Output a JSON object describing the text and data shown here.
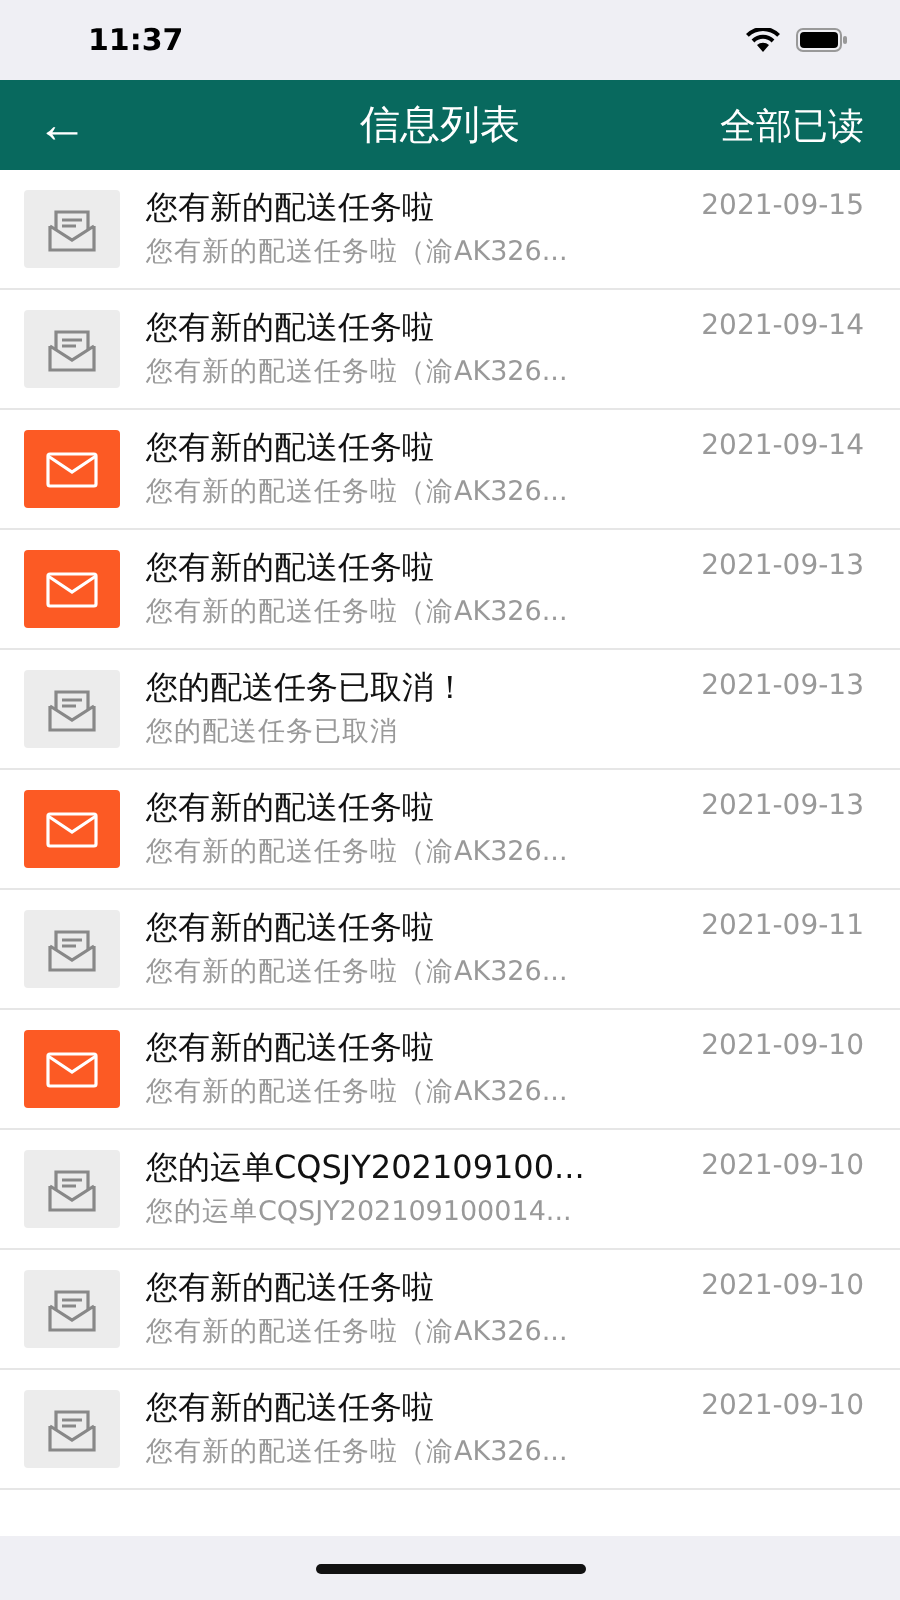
{
  "status_bar": {
    "time": "11:37"
  },
  "header": {
    "back": "←",
    "title": "信息列表",
    "action": "全部已读"
  },
  "messages": [
    {
      "title": "您有新的配送任务啦",
      "preview": "您有新的配送任务啦（渝AK326...",
      "date": "2021-09-15",
      "read": true
    },
    {
      "title": "您有新的配送任务啦",
      "preview": "您有新的配送任务啦（渝AK326...",
      "date": "2021-09-14",
      "read": true
    },
    {
      "title": "您有新的配送任务啦",
      "preview": "您有新的配送任务啦（渝AK326...",
      "date": "2021-09-14",
      "read": false
    },
    {
      "title": "您有新的配送任务啦",
      "preview": "您有新的配送任务啦（渝AK326...",
      "date": "2021-09-13",
      "read": false
    },
    {
      "title": "您的配送任务已取消！",
      "preview": "您的配送任务已取消",
      "date": "2021-09-13",
      "read": true
    },
    {
      "title": "您有新的配送任务啦",
      "preview": "您有新的配送任务啦（渝AK326...",
      "date": "2021-09-13",
      "read": false
    },
    {
      "title": "您有新的配送任务啦",
      "preview": "您有新的配送任务啦（渝AK326...",
      "date": "2021-09-11",
      "read": true
    },
    {
      "title": "您有新的配送任务啦",
      "preview": "您有新的配送任务啦（渝AK326...",
      "date": "2021-09-10",
      "read": false
    },
    {
      "title": "您的运单CQSJY202109100...",
      "preview": "您的运单CQSJY202109100014...",
      "date": "2021-09-10",
      "read": true
    },
    {
      "title": "您有新的配送任务啦",
      "preview": "您有新的配送任务啦（渝AK326...",
      "date": "2021-09-10",
      "read": true
    },
    {
      "title": "您有新的配送任务啦",
      "preview": "您有新的配送任务啦（渝AK326...",
      "date": "2021-09-10",
      "read": true
    }
  ]
}
